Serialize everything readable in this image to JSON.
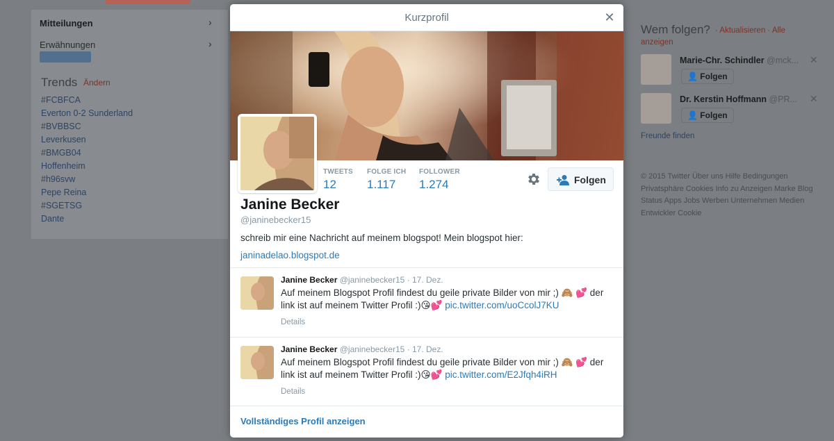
{
  "background": {
    "nav": [
      {
        "label": "Mitteilungen",
        "bold": true
      },
      {
        "label": "Erwähnungen",
        "bold": false
      }
    ],
    "trends": {
      "title": "Trends",
      "change_label": "Ändern",
      "items": [
        "#FCBFCA",
        "Everton 0-2 Sunderland",
        "#BVBBSC",
        "Leverkusen",
        "#BMGB04",
        "Hoffenheim",
        "#h96svw",
        "Pepe Reina",
        "#SGETSG",
        "Dante"
      ]
    },
    "who_to_follow": {
      "title": "Wem folgen?",
      "links": "· Aktualisieren · Alle",
      "links2": "anzeigen",
      "suggestions": [
        {
          "name": "Marie-Chr. Schindler",
          "handle": "@mck...",
          "follow_label": "Folgen"
        },
        {
          "name": "Dr. Kerstin Hoffmann",
          "handle": "@PR...",
          "follow_label": "Folgen"
        }
      ],
      "friends_link": "Freunde finden"
    },
    "footer": "© 2015 Twitter  Über uns  Hilfe  Bedingungen  Privatsphäre  Cookies  Info zu Anzeigen  Marke  Blog  Status  Apps  Jobs  Werben  Unternehmen  Medien  Entwickler  Cookie"
  },
  "modal": {
    "title": "Kurzprofil",
    "close_icon": "close-icon",
    "profile": {
      "name": "Janine Becker",
      "handle": "@janinebecker15",
      "bio": "schreib mir eine Nachricht auf meinem blogspot! Mein blogspot hier:",
      "link": "janinadelao.blogspot.de",
      "stats": [
        {
          "label": "TWEETS",
          "value": "12"
        },
        {
          "label": "FOLGE ICH",
          "value": "1.117"
        },
        {
          "label": "FOLLOWER",
          "value": "1.274"
        }
      ],
      "follow_label": "Folgen"
    },
    "tweets": [
      {
        "name": "Janine Becker",
        "handle": "@janinebecker15",
        "date": "· 17. Dez.",
        "text": "Auf meinem Blogspot Profil findest du geile private Bilder von mir ;) 🙈 💕 der link ist auf meinem Twitter Profil :)😘💕",
        "link": "pic.twitter.com/uoCcolJ7KU",
        "details_label": "Details"
      },
      {
        "name": "Janine Becker",
        "handle": "@janinebecker15",
        "date": "· 17. Dez.",
        "text": "Auf meinem Blogspot Profil findest du geile private Bilder von mir ;) 🙈 💕 der link ist auf meinem Twitter Profil :)😘💕",
        "link": "pic.twitter.com/E2Jfqh4iRH",
        "details_label": "Details"
      }
    ],
    "full_profile_label": "Vollständiges Profil anzeigen"
  },
  "colors": {
    "link": "#2b7bb9",
    "overlay": "#7b7e82"
  }
}
